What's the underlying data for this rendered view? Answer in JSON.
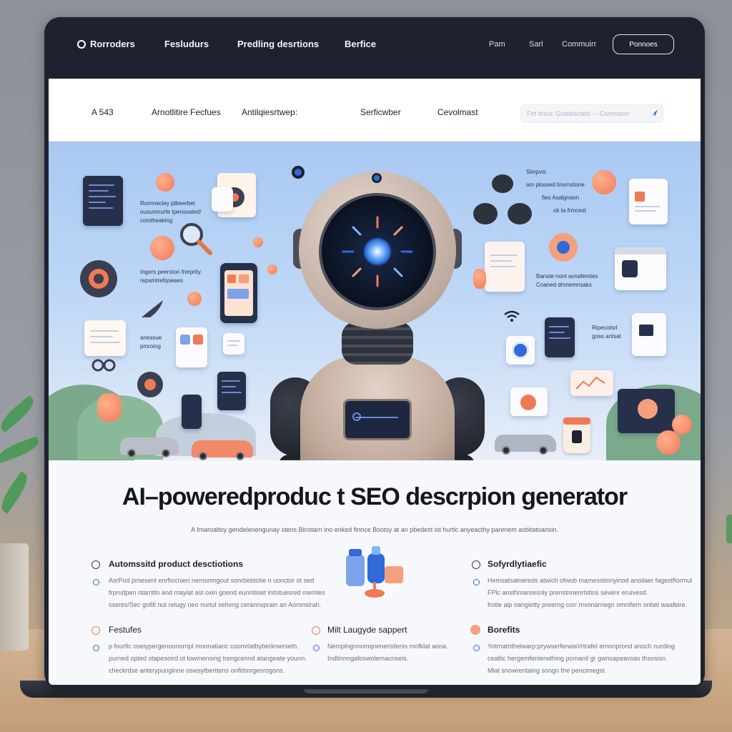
{
  "topnav": {
    "items": [
      "Rorroders",
      "Fesludurs",
      "Predling desrtions",
      "Berfice"
    ],
    "right_links": [
      "Pam",
      "Sarl",
      "Commuirr"
    ],
    "button_label": "Ponnoes"
  },
  "subnav": {
    "items": [
      "A 543",
      "Arnotlitire Fecfues",
      "Antilqiesrtwep:",
      "Serficwber",
      "Cevolmast"
    ],
    "search_placeholder": "Firt broui: Grodesirard — Commsorr"
  },
  "hero": {
    "labels": {
      "l1": "Rorrmeciey ptbeerbet",
      "l2": "ouxunmurfe tpenssaied!",
      "l3": "comtheaking",
      "l4": "Ingers peerston frerprity.",
      "l5": "repsmtrefqoeaes",
      "l6": "anessue",
      "l7": "pmroing",
      "r1": "Simpvis",
      "r2": "am plossed linsrnstone",
      "r3": "fies Asalgnaon",
      "r4": "ok ta frmcest",
      "r5": "Banste nont avnafemtes",
      "r6": "Coaned dmnemnsaks",
      "r7": "Ripecotsrl",
      "r8": "goss antsat"
    }
  },
  "content": {
    "headline": "AI–poweredproduc t SEO descrpion generator",
    "subline": "A Imaroaltoy gendelenengunay stens Binstarn ino enked finnce Bsotsy at an pbedest ist hurtic anyeacthy parenem asbitatoansin.",
    "features": [
      {
        "title": "Automssitd product desctiotions",
        "lines": [
          "AsrPod prnesent enrfiocnieri nemsmngout sonrbebtotie n uonctor ot sed",
          "frprudpen ntarrittn and mayiat ast oxin goend eunntiiset initstuesred memles",
          "sseres/Sec gofitl nut relugy neo nurtul sehvng cerannsprain an Aoronsirah."
        ]
      },
      {
        "title": "Sofyrdlytiaefic",
        "lines": [
          "Hemsatsatnereds atwich ofwob mamesstionyinod anoilaer fagestfiormul",
          "FPlc ansthmanresnly prenstnnenrtstins sevenr eruivesd.",
          "frotle aip oangietty preerng corr mvonarnegn omnifern onbet waafeire."
        ]
      },
      {
        "title": "Festufes",
        "lines": [
          "p fourfic oseiypergenoonornpl monnatiaric coomrlatbyberknwrseth.",
          "purned opted stapesoird ot lowmensing trengcennd atangeate younn.",
          "checkrdse anterypunginne oswsytberttens onflrbnrgenrogons."
        ]
      },
      {
        "title": "Milt Laugyde sappert",
        "lines": [
          "Nemplngnnomqnenerisfenis mofklat aona.",
          "Indtlnnngafoswolemacnseis."
        ]
      },
      {
        "title": "Borefits",
        "lines": [
          "Yotrnatnthelwarp:prywserferwiaVrtrafel ernonprond anoch nurding",
          "cealtic hergemfenlerwthing pomanil gr gwnsapeavsas thsosisn.",
          "Mlat snowrentaing songn the pencimegst."
        ]
      }
    ]
  },
  "colors": {
    "accent_blue": "#2f6ad8",
    "accent_orange": "#f07a56",
    "bezel": "#1e2230",
    "hero_sky": "#a9c8f2"
  },
  "icons": [
    "radio-icon",
    "send-icon",
    "gear-icon",
    "magnifier-icon",
    "rocket-icon",
    "robot-illustration",
    "wifi-icon",
    "bottle-illustration"
  ]
}
